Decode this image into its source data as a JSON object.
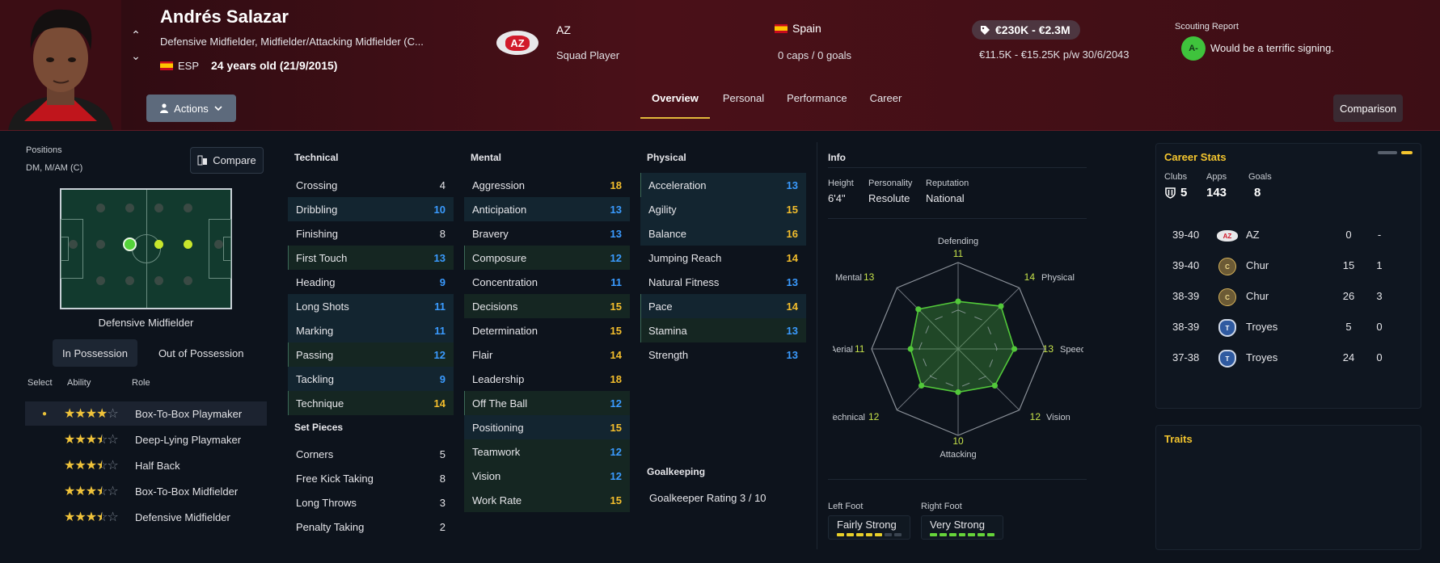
{
  "player": {
    "name": "Andrés Salazar",
    "positions": "Defensive Midfielder, Midfielder/Attacking Midfielder (C...",
    "nation_code": "ESP",
    "age": "24 years old (21/9/2015)"
  },
  "header": {
    "actions_label": "Actions",
    "club_logo_text": "AZ",
    "club": "AZ",
    "squad_role": "Squad Player",
    "nation": "Spain",
    "caps": "0 caps / 0 goals",
    "value": "€230K - €2.3M",
    "wage": "€11.5K - €15.25K p/w 30/6/2043",
    "scouting_title": "Scouting Report",
    "scouting_grade": "A-",
    "scouting_text": "Would be a terrific signing.",
    "tabs": [
      "Overview",
      "Personal",
      "Performance",
      "Career"
    ],
    "comparison_label": "Comparison"
  },
  "positions_panel": {
    "label": "Positions",
    "value": "DM, M/AM (C)",
    "compare_label": "Compare",
    "selected_role": "Defensive Midfielder",
    "tabs": [
      "In Possession",
      "Out of Possession"
    ],
    "headers": [
      "Select",
      "Ability",
      "Role"
    ],
    "roles": [
      {
        "name": "Box-To-Box Playmaker",
        "stars": 4.0,
        "selected": true
      },
      {
        "name": "Deep-Lying Playmaker",
        "stars": 3.5,
        "selected": false
      },
      {
        "name": "Half Back",
        "stars": 3.5,
        "selected": false
      },
      {
        "name": "Box-To-Box Midfielder",
        "stars": 3.5,
        "selected": false
      },
      {
        "name": "Defensive Midfielder",
        "stars": 3.5,
        "selected": false
      }
    ]
  },
  "technical": {
    "title": "Technical",
    "attrs": [
      {
        "name": "Crossing",
        "value": "4"
      },
      {
        "name": "Dribbling",
        "value": "10"
      },
      {
        "name": "Finishing",
        "value": "8"
      },
      {
        "name": "First Touch",
        "value": "13"
      },
      {
        "name": "Heading",
        "value": "9"
      },
      {
        "name": "Long Shots",
        "value": "11"
      },
      {
        "name": "Marking",
        "value": "11"
      },
      {
        "name": "Passing",
        "value": "12"
      },
      {
        "name": "Tackling",
        "value": "9"
      },
      {
        "name": "Technique",
        "value": "14"
      }
    ]
  },
  "set_pieces": {
    "title": "Set Pieces",
    "attrs": [
      {
        "name": "Corners",
        "value": "5"
      },
      {
        "name": "Free Kick Taking",
        "value": "8"
      },
      {
        "name": "Long Throws",
        "value": "3"
      },
      {
        "name": "Penalty Taking",
        "value": "2"
      }
    ]
  },
  "mental": {
    "title": "Mental",
    "attrs": [
      {
        "name": "Aggression",
        "value": "18"
      },
      {
        "name": "Anticipation",
        "value": "13"
      },
      {
        "name": "Bravery",
        "value": "13"
      },
      {
        "name": "Composure",
        "value": "12"
      },
      {
        "name": "Concentration",
        "value": "11"
      },
      {
        "name": "Decisions",
        "value": "15"
      },
      {
        "name": "Determination",
        "value": "15"
      },
      {
        "name": "Flair",
        "value": "14"
      },
      {
        "name": "Leadership",
        "value": "18"
      },
      {
        "name": "Off The Ball",
        "value": "12"
      },
      {
        "name": "Positioning",
        "value": "15"
      },
      {
        "name": "Teamwork",
        "value": "12"
      },
      {
        "name": "Vision",
        "value": "12"
      },
      {
        "name": "Work Rate",
        "value": "15"
      }
    ]
  },
  "physical": {
    "title": "Physical",
    "attrs": [
      {
        "name": "Acceleration",
        "value": "13"
      },
      {
        "name": "Agility",
        "value": "15"
      },
      {
        "name": "Balance",
        "value": "16"
      },
      {
        "name": "Jumping Reach",
        "value": "14"
      },
      {
        "name": "Natural Fitness",
        "value": "13"
      },
      {
        "name": "Pace",
        "value": "14"
      },
      {
        "name": "Stamina",
        "value": "13"
      },
      {
        "name": "Strength",
        "value": "13"
      }
    ]
  },
  "goalkeeping": {
    "title": "Goalkeeping",
    "rating": "Goalkeeper Rating 3 / 10"
  },
  "info": {
    "title": "Info",
    "height_label": "Height",
    "height": "6'4\"",
    "personality_label": "Personality",
    "personality": "Resolute",
    "reputation_label": "Reputation",
    "reputation": "National",
    "left_foot_label": "Left Foot",
    "left_foot": "Fairly Strong",
    "left_foot_level": 5,
    "right_foot_label": "Right Foot",
    "right_foot": "Very Strong",
    "right_foot_level": 7,
    "radar": [
      {
        "name": "Defending",
        "value": 11
      },
      {
        "name": "Physical",
        "value": 14
      },
      {
        "name": "Speed",
        "value": 13
      },
      {
        "name": "Vision",
        "value": 12
      },
      {
        "name": "Attacking",
        "value": 10
      },
      {
        "name": "Technical",
        "value": 12
      },
      {
        "name": "Aerial",
        "value": 11
      },
      {
        "name": "Mental",
        "value": 13
      }
    ],
    "radar_max": 20
  },
  "career_stats": {
    "title": "Career Stats",
    "clubs_label": "Clubs",
    "clubs": "5",
    "apps_label": "Apps",
    "apps": "143",
    "goals_label": "Goals",
    "goals": "8",
    "rows": [
      {
        "season": "39-40",
        "club": "AZ",
        "badge": "az",
        "apps": "0",
        "goals": "-"
      },
      {
        "season": "39-40",
        "club": "Chur",
        "badge": "chur",
        "apps": "15",
        "goals": "1"
      },
      {
        "season": "38-39",
        "club": "Chur",
        "badge": "chur",
        "apps": "26",
        "goals": "3"
      },
      {
        "season": "38-39",
        "club": "Troyes",
        "badge": "troyes",
        "apps": "5",
        "goals": "0"
      },
      {
        "season": "37-38",
        "club": "Troyes",
        "badge": "troyes",
        "apps": "24",
        "goals": "0"
      }
    ]
  },
  "traits": {
    "title": "Traits"
  },
  "colors": {
    "gold": "#f4be2c",
    "blue": "#3a9bff",
    "green": "#54d33a",
    "header_red": "#4a1018"
  }
}
